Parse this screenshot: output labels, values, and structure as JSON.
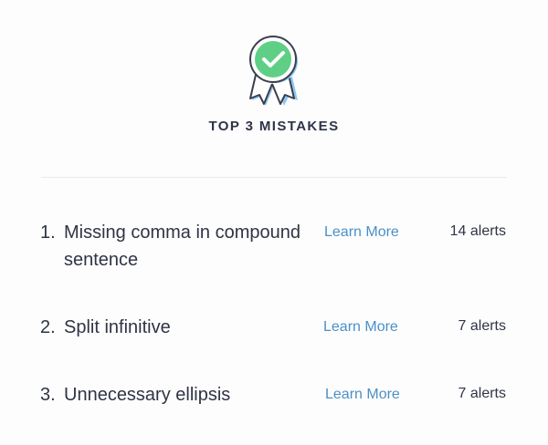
{
  "header": {
    "title": "TOP 3 MISTAKES",
    "icon": "award-ribbon-check-icon",
    "colors": {
      "badge_green": "#5fcf86",
      "ribbon_blue": "#8ec8f2",
      "outline": "#3a3f4e"
    }
  },
  "mistakes": [
    {
      "index": "1.",
      "title": "Missing comma in compound sentence",
      "link_label": "Learn More",
      "alerts": "14 alerts"
    },
    {
      "index": "2.",
      "title": "Split infinitive",
      "link_label": "Learn More",
      "alerts": "7 alerts"
    },
    {
      "index": "3.",
      "title": "Unnecessary ellipsis",
      "link_label": "Learn More",
      "alerts": "7 alerts"
    }
  ],
  "colors": {
    "text": "#2f3445",
    "link": "#4a90c8",
    "divider": "#e9ebee"
  }
}
